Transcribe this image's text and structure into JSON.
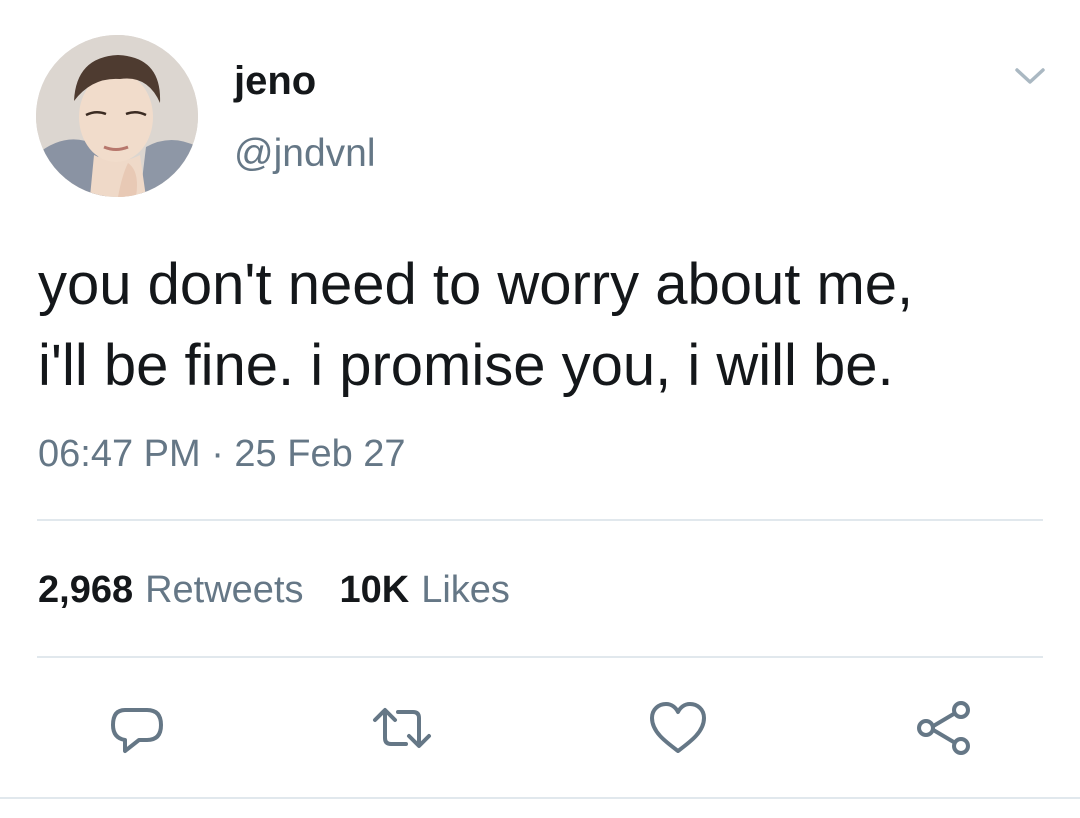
{
  "author": {
    "display_name": "jeno",
    "handle": "@jndvnl",
    "avatar": "profile-photo"
  },
  "tweet": {
    "lines": [
      "you don't need to worry about me,",
      "i'll be fine. i promise you, i will be."
    ],
    "timestamp": "06:47 PM · 25 Feb 27"
  },
  "stats": {
    "retweets_count": "2,968",
    "retweets_label": "Retweets",
    "likes_count": "10K",
    "likes_label": "Likes"
  },
  "actions": [
    "reply-icon",
    "retweet-icon",
    "like-icon",
    "share-icon"
  ],
  "colors": {
    "text": "#14171a",
    "secondary": "#657786",
    "divider": "#e1e8ed",
    "icon": "#657786"
  }
}
